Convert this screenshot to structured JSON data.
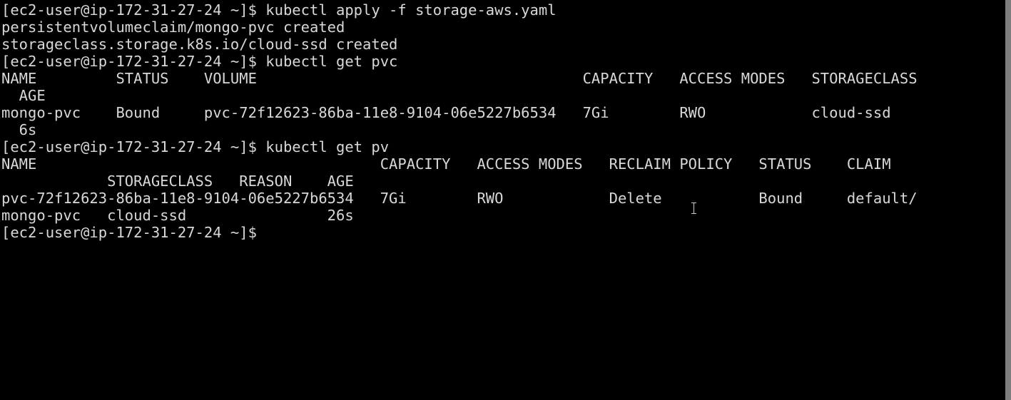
{
  "terminal": {
    "lines": [
      "[ec2-user@ip-172-31-27-24 ~]$ kubectl apply -f storage-aws.yaml",
      "persistentvolumeclaim/mongo-pvc created",
      "storageclass.storage.k8s.io/cloud-ssd created",
      "[ec2-user@ip-172-31-27-24 ~]$ kubectl get pvc",
      "NAME         STATUS    VOLUME                                     CAPACITY   ACCESS MODES   STORAGECLASS",
      "  AGE",
      "mongo-pvc    Bound     pvc-72f12623-86ba-11e8-9104-06e5227b6534   7Gi        RWO            cloud-ssd",
      "  6s",
      "[ec2-user@ip-172-31-27-24 ~]$ kubectl get pv",
      "NAME                                       CAPACITY   ACCESS MODES   RECLAIM POLICY   STATUS    CLAIM",
      "            STORAGECLASS   REASON    AGE",
      "pvc-72f12623-86ba-11e8-9104-06e5227b6534   7Gi        RWO            Delete           Bound     default/",
      "mongo-pvc   cloud-ssd                26s",
      "[ec2-user@ip-172-31-27-24 ~]$"
    ]
  }
}
